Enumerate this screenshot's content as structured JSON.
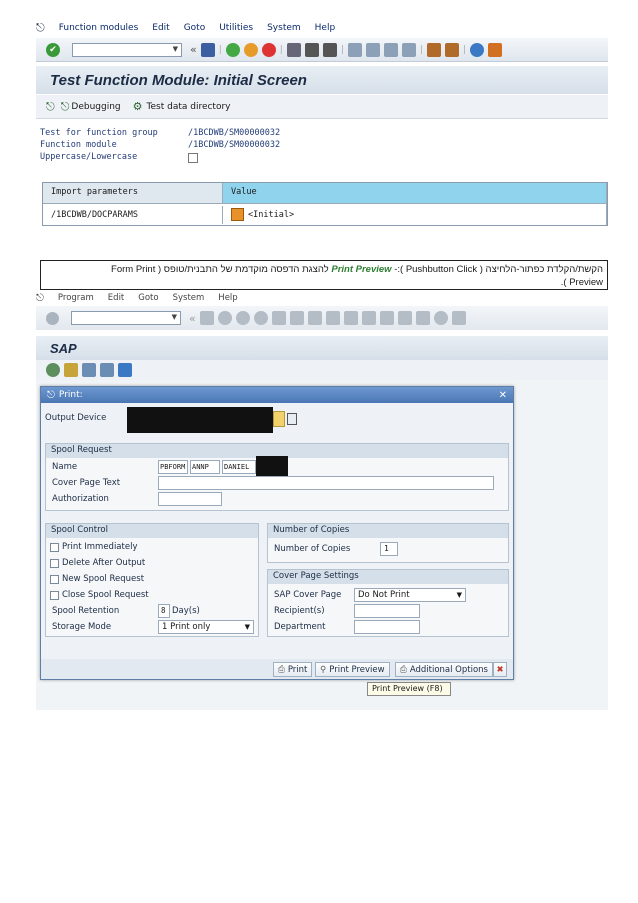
{
  "screen1": {
    "menu": [
      "Function modules",
      "Edit",
      "Goto",
      "Utilities",
      "System",
      "Help"
    ],
    "title": "Test Function Module: Initial Screen",
    "app_toolbar": {
      "debugging": "Debugging",
      "test_data_directory": "Test data directory"
    },
    "fields": [
      {
        "label": "Test for function group",
        "value": "/1BCDWB/SM00000032"
      },
      {
        "label": "Function module",
        "value": "/1BCDWB/SM00000032"
      },
      {
        "label": "Uppercase/Lowercase",
        "value": ""
      }
    ],
    "table": {
      "headers": [
        "Import parameters",
        "Value"
      ],
      "rows": [
        {
          "param": "/1BCDWB/DOCPARAMS",
          "value": "<Initial>"
        }
      ]
    }
  },
  "instruction": {
    "line1_pre": "הקשת/הקלדת כפתור-הלחיצה ( Pushbutton Click ):- ",
    "line1_highlight": "Print Preview",
    "line1_post": " להצגת הדפסה מוקדמת של התבנית/טופס ( Form Print",
    "line2": "Preview )."
  },
  "screen2": {
    "menu": [
      "Program",
      "Edit",
      "Goto",
      "System",
      "Help"
    ],
    "title": "SAP",
    "dialog": {
      "title": "Print:",
      "output_device_label": "Output Device",
      "spool_request": {
        "header": "Spool Request",
        "name_label": "Name",
        "name_parts": [
          "PBFORM",
          "ANNP",
          "DANIEL"
        ],
        "cover_page_text_label": "Cover Page Text",
        "authorization_label": "Authorization"
      },
      "spool_control": {
        "header": "Spool Control",
        "print_immediately": "Print Immediately",
        "delete_after_output": "Delete After Output",
        "new_spool_request": "New Spool Request",
        "close_spool_request": "Close Spool Request",
        "spool_retention_label": "Spool Retention",
        "spool_retention_value": "8",
        "spool_retention_unit": "Day(s)",
        "storage_mode_label": "Storage Mode",
        "storage_mode_value": "1 Print only"
      },
      "copies": {
        "header": "Number of Copies",
        "label": "Number of Copies",
        "value": "1"
      },
      "cover_page": {
        "header": "Cover Page Settings",
        "sap_cover_page_label": "SAP Cover Page",
        "sap_cover_page_value": "Do Not Print",
        "recipients_label": "Recipient(s)",
        "department_label": "Department"
      },
      "buttons": {
        "print": "Print",
        "print_preview": "Print Preview",
        "additional_options": "Additional Options"
      },
      "tooltip": "Print Preview    (F8)"
    }
  }
}
